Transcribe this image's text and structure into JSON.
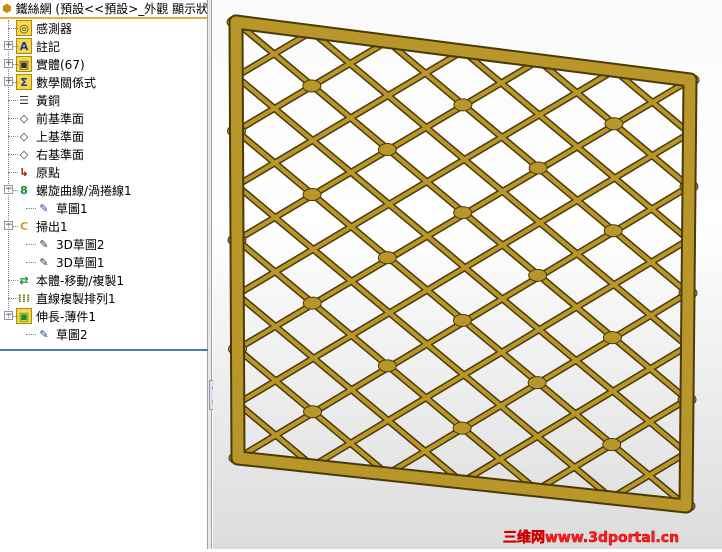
{
  "tree": {
    "title": "鐵絲網  (預設<<預設>_外觀 顯示狀",
    "items": [
      {
        "label": "感測器",
        "icon": "sensor-icon",
        "expand": ""
      },
      {
        "label": "註記",
        "icon": "annotation-icon",
        "expand": "+"
      },
      {
        "label": "實體(67)",
        "icon": "solid-bodies-icon",
        "expand": "+"
      },
      {
        "label": "數學關係式",
        "icon": "equations-icon",
        "expand": "+"
      },
      {
        "label": "黃銅",
        "icon": "material-icon",
        "expand": ""
      },
      {
        "label": "前基準面",
        "icon": "plane-icon",
        "expand": ""
      },
      {
        "label": "上基準面",
        "icon": "plane-icon",
        "expand": ""
      },
      {
        "label": "右基準面",
        "icon": "plane-icon",
        "expand": ""
      },
      {
        "label": "原點",
        "icon": "origin-icon",
        "expand": ""
      },
      {
        "label": "螺旋曲線/渦捲線1",
        "icon": "helix-icon",
        "expand": "-"
      },
      {
        "label": "草圖1",
        "icon": "sketch-icon",
        "expand": "",
        "child": true
      },
      {
        "label": "掃出1",
        "icon": "sweep-icon",
        "expand": "-"
      },
      {
        "label": "3D草圖2",
        "icon": "3d-sketch-icon",
        "expand": "",
        "child": true
      },
      {
        "label": "3D草圖1",
        "icon": "3d-sketch-icon",
        "expand": "",
        "child": true
      },
      {
        "label": "本體-移動/複製1",
        "icon": "move-copy-icon",
        "expand": ""
      },
      {
        "label": "直線複製排列1",
        "icon": "linear-pattern-icon",
        "expand": ""
      },
      {
        "label": "伸長-薄件1",
        "icon": "extrude-thin-icon",
        "expand": "-"
      },
      {
        "label": "草圖2",
        "icon": "sketch-icon",
        "expand": "",
        "child": true
      }
    ]
  },
  "viewport": {
    "frame_color": "#b8962a",
    "edge_color": "#4a3a08",
    "watermark": "三维网www.3dportal.cn"
  }
}
